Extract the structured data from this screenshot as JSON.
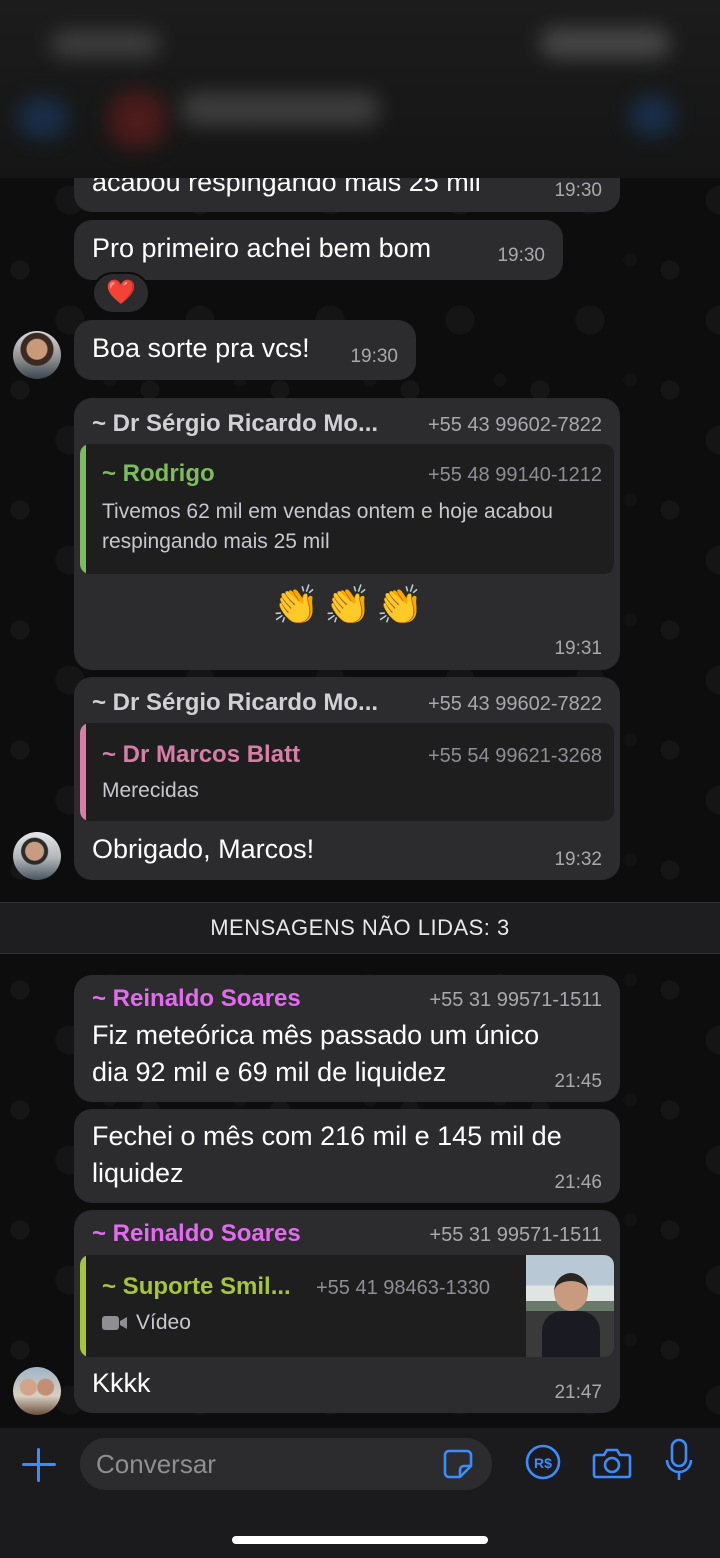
{
  "colors": {
    "bubble": "#2c2c2e",
    "accent_blue": "#3b8cff",
    "sender_gray": "#d0d0d5",
    "rodrigo_green": "#7cbb5f",
    "marcos_pink": "#d67da8",
    "reinaldo_magenta": "#e36bf0",
    "suporte_lime": "#a4c639"
  },
  "messages": {
    "m1": {
      "text": "acabou respingando mais 25 mil",
      "time": "19:30"
    },
    "m2": {
      "text": "Pro primeiro achei bem bom",
      "time": "19:30",
      "reaction": "❤️"
    },
    "m3": {
      "text": "Boa sorte pra vcs!",
      "time": "19:30"
    },
    "m4": {
      "sender": "~ Dr Sérgio Ricardo Mo...",
      "phone": "+55 43 99602-7822",
      "quote": {
        "name": "~ Rodrigo",
        "phone": "+55 48 99140-1212",
        "text_line1": "Tivemos 62 mil em vendas ontem e hoje acabou",
        "text_line2": "respingando mais 25 mil"
      },
      "emoji": [
        "👏",
        "👏",
        "👏"
      ],
      "time": "19:31"
    },
    "m5": {
      "sender": "~ Dr Sérgio Ricardo Mo...",
      "phone": "+55 43 99602-7822",
      "quote": {
        "name": "~ Dr Marcos Blatt",
        "phone": "+55 54 99621-3268",
        "text": "Merecidas"
      },
      "text": "Obrigado, Marcos!",
      "time": "19:32"
    },
    "unread_label": "MENSAGENS NÃO LIDAS: 3",
    "m6": {
      "sender": "~ Reinaldo Soares",
      "phone": "+55 31 99571-1511",
      "text_line1": "Fiz meteórica mês passado um único",
      "text_line2": "dia 92 mil e 69 mil de liquidez",
      "time": "21:45"
    },
    "m7": {
      "text_line1": "Fechei o mês com 216 mil e 145 mil de",
      "text_line2": "liquidez",
      "time": "21:46"
    },
    "m8": {
      "sender": "~ Reinaldo Soares",
      "phone": "+55 31 99571-1511",
      "quote": {
        "name": "~ Suporte Smil...",
        "phone": "+55 41 98463-1330",
        "media_label": "Vídeo"
      },
      "text": "Kkkk",
      "time": "21:47"
    }
  },
  "input": {
    "placeholder": "Conversar"
  },
  "icons": [
    "plus-icon",
    "sticker-icon",
    "pix-payment-icon",
    "camera-icon",
    "microphone-icon",
    "video-icon"
  ]
}
